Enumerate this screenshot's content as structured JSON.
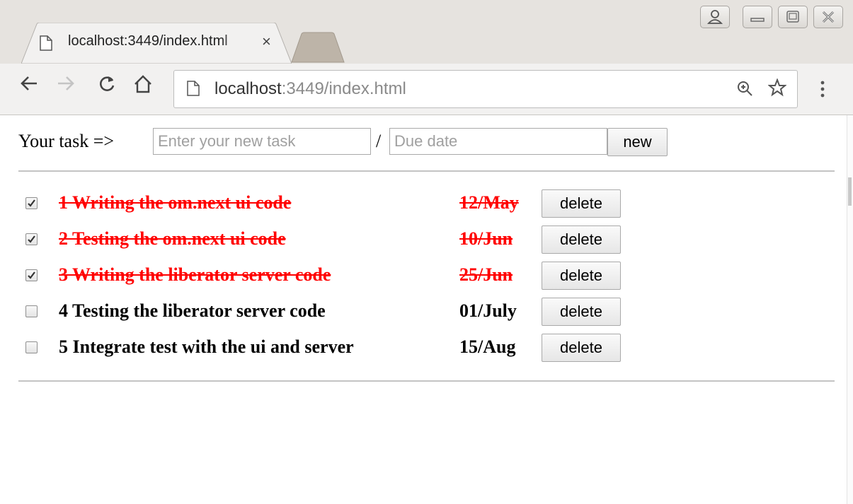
{
  "browser": {
    "tab_title": "localhost:3449/index.html",
    "tab_close": "×",
    "url_host": "localhost",
    "url_path": ":3449/index.html"
  },
  "form": {
    "label": "Your task =>",
    "task_placeholder": "Enter your new task",
    "separator": "/",
    "due_placeholder": "Due date",
    "new_button": "new"
  },
  "tasks": [
    {
      "text": "1 Writing the om.next ui code",
      "due": "12/May",
      "done": true,
      "delete_label": "delete"
    },
    {
      "text": "2 Testing the om.next ui code",
      "due": "10/Jun",
      "done": true,
      "delete_label": "delete"
    },
    {
      "text": "3 Writing the liberator server code",
      "due": "25/Jun",
      "done": true,
      "delete_label": "delete"
    },
    {
      "text": "4 Testing the liberator server code",
      "due": "01/July",
      "done": false,
      "delete_label": "delete"
    },
    {
      "text": "5 Integrate test with the ui and server",
      "due": "15/Aug",
      "done": false,
      "delete_label": "delete"
    }
  ],
  "colors": {
    "done_text": "#ff0000",
    "normal_text": "#000000",
    "chrome_bg": "#e6e3df"
  }
}
